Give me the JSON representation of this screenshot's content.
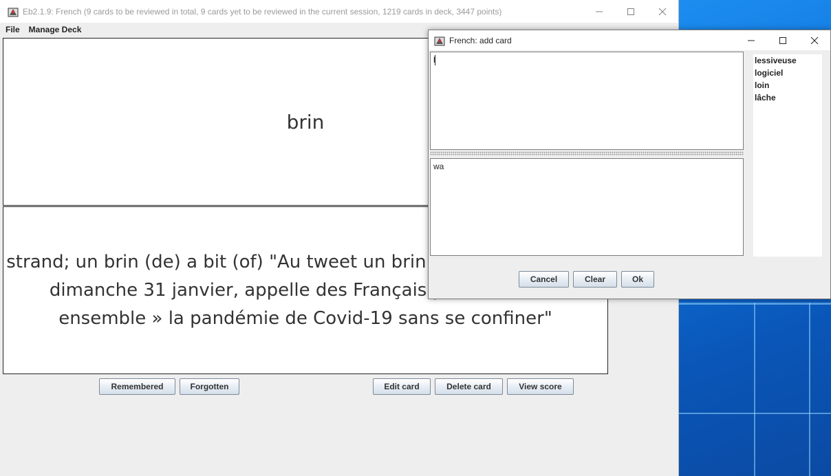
{
  "main_window": {
    "title": "Eb2.1.9: French (9 cards to be reviewed in total, 9 cards yet to be reviewed in the current session, 1219 cards in deck, 3447 points)",
    "menu": [
      "File",
      "Manage Deck"
    ],
    "front": "brin",
    "back": "strand; un brin (de) a bit (of) \"Au tweet un brin Emmanuel Macron, dimanche 31 janvier, appelle des Français pour vaincre « ensemble » la pandémie de Covid-19 sans se confiner\"",
    "buttons": {
      "remembered": "Remembered",
      "forgotten": "Forgotten",
      "edit": "Edit card",
      "delete": "Delete card",
      "view_score": "View score"
    }
  },
  "dialog": {
    "title": "French: add card",
    "field1_value": "l",
    "field2_value": "wa",
    "suggestions": [
      "lessiveuse",
      "logiciel",
      "loin",
      "lâche"
    ],
    "buttons": {
      "cancel": "Cancel",
      "clear": "Clear",
      "ok": "Ok"
    }
  },
  "colors": {
    "desktop_red": "#ff0000",
    "desktop_blue": "#0e6fd8"
  }
}
